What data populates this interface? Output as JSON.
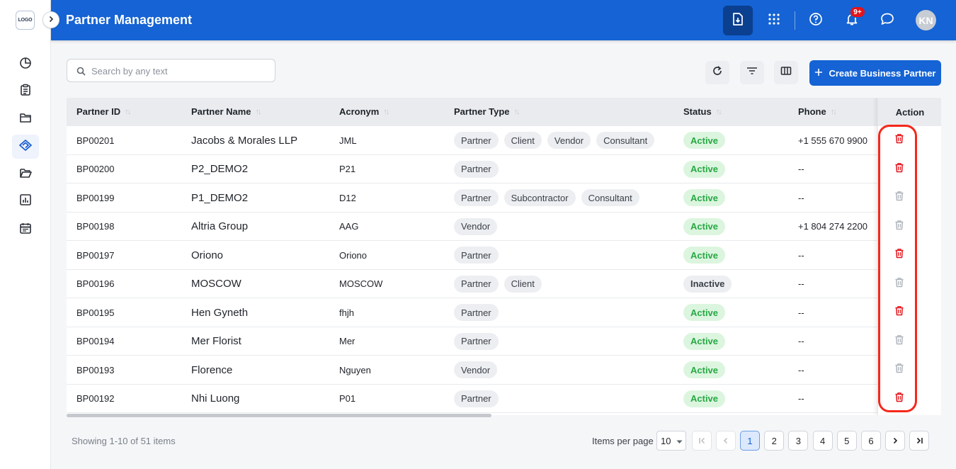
{
  "app": {
    "logo_text": "LOGO",
    "title": "Partner Management",
    "notification_count": "9+",
    "user_initials": "KN"
  },
  "toolbar": {
    "search_placeholder": "Search by any text",
    "create_label": "Create Business Partner"
  },
  "table": {
    "columns": {
      "partner_id": "Partner ID",
      "partner_name": "Partner Name",
      "acronym": "Acronym",
      "partner_type": "Partner Type",
      "status": "Status",
      "phone": "Phone",
      "action": "Action"
    },
    "rows": [
      {
        "id": "BP00201",
        "name": "Jacobs & Morales LLP",
        "acronym": "JML",
        "types": [
          "Partner",
          "Client",
          "Vendor",
          "Consultant"
        ],
        "status": "Active",
        "phone": "+1 555 670 9900",
        "delete_enabled": true
      },
      {
        "id": "BP00200",
        "name": "P2_DEMO2",
        "acronym": "P21",
        "types": [
          "Partner"
        ],
        "status": "Active",
        "phone": "--",
        "delete_enabled": true
      },
      {
        "id": "BP00199",
        "name": "P1_DEMO2",
        "acronym": "D12",
        "types": [
          "Partner",
          "Subcontractor",
          "Consultant"
        ],
        "status": "Active",
        "phone": "--",
        "delete_enabled": false
      },
      {
        "id": "BP00198",
        "name": "Altria Group",
        "acronym": "AAG",
        "types": [
          "Vendor"
        ],
        "status": "Active",
        "phone": "+1 804 274 2200",
        "delete_enabled": false
      },
      {
        "id": "BP00197",
        "name": "Oriono",
        "acronym": "Oriono",
        "types": [
          "Partner"
        ],
        "status": "Active",
        "phone": "--",
        "delete_enabled": true
      },
      {
        "id": "BP00196",
        "name": "MOSCOW",
        "acronym": "MOSCOW",
        "types": [
          "Partner",
          "Client"
        ],
        "status": "Inactive",
        "phone": "--",
        "delete_enabled": false
      },
      {
        "id": "BP00195",
        "name": "Hen Gyneth",
        "acronym": "fhjh",
        "types": [
          "Partner"
        ],
        "status": "Active",
        "phone": "--",
        "delete_enabled": true
      },
      {
        "id": "BP00194",
        "name": "Mer Florist",
        "acronym": "Mer",
        "types": [
          "Partner"
        ],
        "status": "Active",
        "phone": "--",
        "delete_enabled": false
      },
      {
        "id": "BP00193",
        "name": "Florence",
        "acronym": "Nguyen",
        "types": [
          "Vendor"
        ],
        "status": "Active",
        "phone": "--",
        "delete_enabled": false
      },
      {
        "id": "BP00192",
        "name": "Nhi Luong",
        "acronym": "P01",
        "types": [
          "Partner"
        ],
        "status": "Active",
        "phone": "--",
        "delete_enabled": true
      }
    ]
  },
  "footer": {
    "showing": "Showing 1-10 of 51 items",
    "items_per_page_label": "Items per page",
    "items_per_page": "10",
    "pages": [
      "1",
      "2",
      "3",
      "4",
      "5",
      "6"
    ],
    "current_page": "1"
  },
  "colors": {
    "brand": "#1563d4",
    "active_status": "#27a844",
    "delete_enabled": "#e3141b",
    "delete_disabled": "#b0b5bc",
    "highlight": "#f5281b"
  }
}
